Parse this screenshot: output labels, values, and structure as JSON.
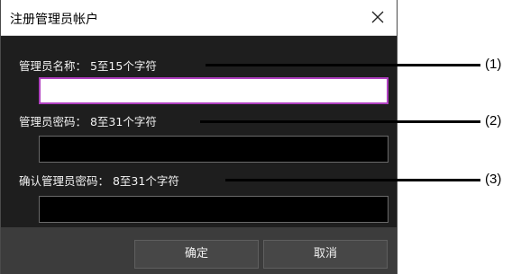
{
  "dialog": {
    "title": "注册管理员帐户",
    "close_icon": "close-icon"
  },
  "fields": [
    {
      "label": "管理员名称： 5至15个字符",
      "value": ""
    },
    {
      "label": "管理员密码： 8至31个字符",
      "value": ""
    },
    {
      "label": "确认管理员密码： 8至31个字符",
      "value": ""
    }
  ],
  "buttons": {
    "ok_label": "确定",
    "cancel_label": "取消"
  },
  "callouts": [
    "(1)",
    "(2)",
    "(3)"
  ],
  "colors": {
    "focus_border": "#b040c0",
    "panel_bg": "#1e1e1e",
    "footer_bg": "#3c3c3c"
  }
}
